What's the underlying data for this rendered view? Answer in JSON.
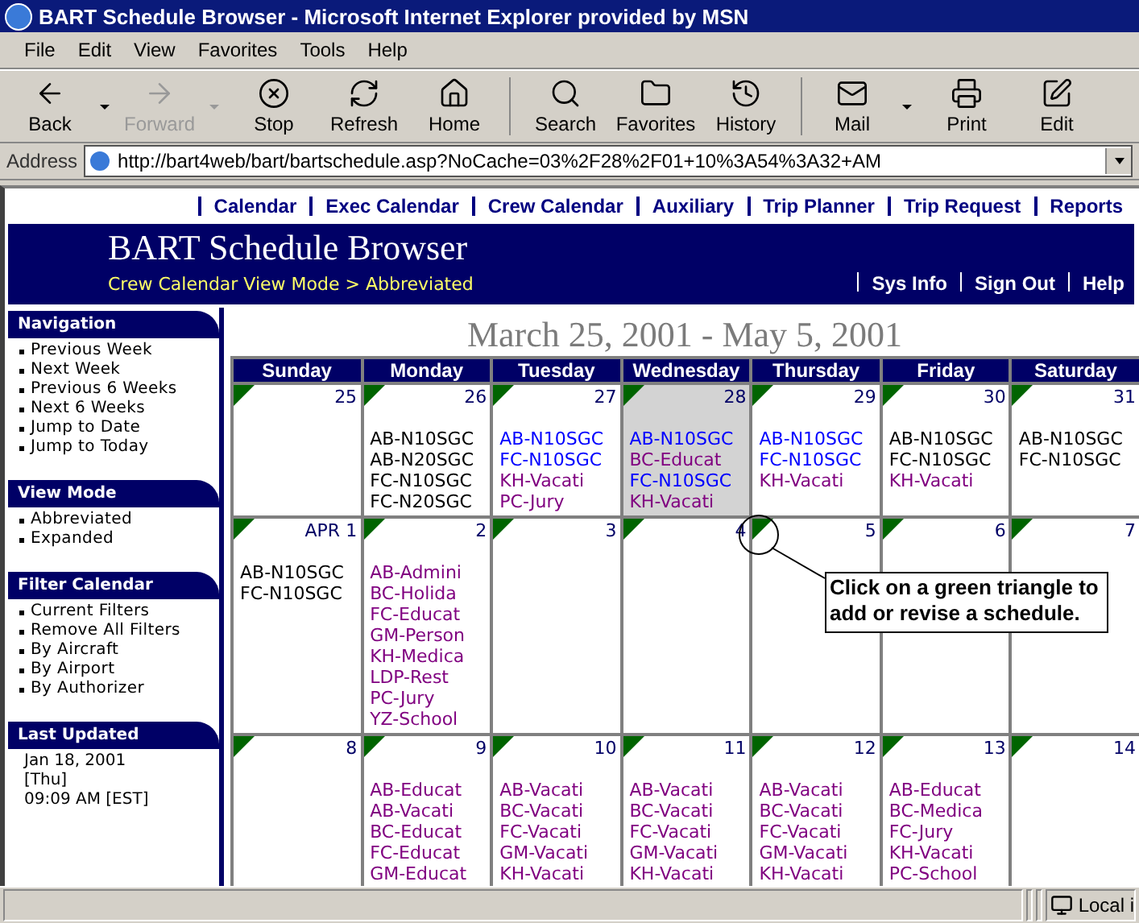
{
  "window": {
    "title": "BART Schedule Browser - Microsoft Internet Explorer provided by MSN"
  },
  "menu": [
    "File",
    "Edit",
    "View",
    "Favorites",
    "Tools",
    "Help"
  ],
  "toolbar": {
    "groups": [
      {
        "buttons": [
          {
            "kind": "back",
            "label": "Back",
            "disabled": false,
            "dropdown": true
          },
          {
            "kind": "forward",
            "label": "Forward",
            "disabled": true,
            "dropdown": true
          },
          {
            "kind": "stop",
            "label": "Stop",
            "disabled": false,
            "dropdown": false
          },
          {
            "kind": "refresh",
            "label": "Refresh",
            "disabled": false,
            "dropdown": false
          },
          {
            "kind": "home",
            "label": "Home",
            "disabled": false,
            "dropdown": false
          }
        ]
      },
      {
        "buttons": [
          {
            "kind": "search",
            "label": "Search",
            "disabled": false,
            "dropdown": false
          },
          {
            "kind": "favorites",
            "label": "Favorites",
            "disabled": false,
            "dropdown": false
          },
          {
            "kind": "history",
            "label": "History",
            "disabled": false,
            "dropdown": false
          }
        ]
      },
      {
        "buttons": [
          {
            "kind": "mail",
            "label": "Mail",
            "disabled": false,
            "dropdown": true
          },
          {
            "kind": "print",
            "label": "Print",
            "disabled": false,
            "dropdown": false
          },
          {
            "kind": "edit",
            "label": "Edit",
            "disabled": false,
            "dropdown": false
          }
        ]
      }
    ]
  },
  "address": {
    "label": "Address",
    "value": "http://bart4web/bart/bartschedule.asp?NoCache=03%2F28%2F01+10%3A54%3A32+AM"
  },
  "top_links": [
    "Calendar",
    "Exec Calendar",
    "Crew Calendar",
    "Auxiliary",
    "Trip Planner",
    "Trip Request",
    "Reports"
  ],
  "header": {
    "title": "BART Schedule Browser",
    "subtitle": "Crew Calendar View Mode > Abbreviated",
    "links": [
      "Sys Info",
      "Sign Out",
      "Help"
    ]
  },
  "sidebar": {
    "sections": [
      {
        "title": "Navigation",
        "items": [
          "Previous Week",
          "Next Week",
          "Previous 6 Weeks",
          "Next 6 Weeks",
          "Jump to Date",
          "Jump to Today"
        ]
      },
      {
        "title": "View Mode",
        "items": [
          "Abbreviated",
          "Expanded"
        ]
      },
      {
        "title": "Filter Calendar",
        "items": [
          "Current Filters",
          "Remove All Filters",
          "By Aircraft",
          "By Airport",
          "By Authorizer"
        ]
      }
    ],
    "last_updated": {
      "title": "Last Updated",
      "lines": [
        "Jan 18, 2001",
        "[Thu]",
        "09:09 AM [EST]"
      ]
    }
  },
  "calendar": {
    "title": "March 25, 2001 - May 5, 2001",
    "weekdays": [
      "Sunday",
      "Monday",
      "Tuesday",
      "Wednesday",
      "Thursday",
      "Friday",
      "Saturday"
    ],
    "weeks": [
      {
        "days": [
          {
            "date": "25",
            "selected": false
          },
          {
            "date": "26",
            "selected": false,
            "entries": [
              {
                "text": "AB-N10SGC",
                "color": "#000000"
              },
              {
                "text": "AB-N20SGC",
                "color": "#000000"
              },
              {
                "text": "FC-N10SGC",
                "color": "#000000"
              },
              {
                "text": "FC-N20SGC",
                "color": "#000000"
              }
            ]
          },
          {
            "date": "27",
            "selected": false,
            "entries": [
              {
                "text": "AB-N10SGC",
                "color": "#0000ff"
              },
              {
                "text": "FC-N10SGC",
                "color": "#0000ff"
              },
              {
                "text": "KH-Vacati",
                "color": "#800080"
              },
              {
                "text": "PC-Jury",
                "color": "#800080"
              }
            ]
          },
          {
            "date": "28",
            "selected": true,
            "entries": [
              {
                "text": "AB-N10SGC",
                "color": "#0000ff"
              },
              {
                "text": "BC-Educat",
                "color": "#800080"
              },
              {
                "text": "FC-N10SGC",
                "color": "#0000ff"
              },
              {
                "text": "KH-Vacati",
                "color": "#800080"
              }
            ]
          },
          {
            "date": "29",
            "selected": false,
            "entries": [
              {
                "text": "AB-N10SGC",
                "color": "#0000ff"
              },
              {
                "text": "FC-N10SGC",
                "color": "#0000ff"
              },
              {
                "text": "KH-Vacati",
                "color": "#800080"
              }
            ]
          },
          {
            "date": "30",
            "selected": false,
            "entries": [
              {
                "text": "AB-N10SGC",
                "color": "#000000"
              },
              {
                "text": "FC-N10SGC",
                "color": "#000000"
              },
              {
                "text": "KH-Vacati",
                "color": "#800080"
              }
            ]
          },
          {
            "date": "31",
            "selected": false,
            "entries": [
              {
                "text": "AB-N10SGC",
                "color": "#000000"
              },
              {
                "text": "FC-N10SGC",
                "color": "#000000"
              }
            ]
          }
        ]
      },
      {
        "days": [
          {
            "date": "APR 1",
            "selected": false,
            "entries": [
              {
                "text": "AB-N10SGC",
                "color": "#000000"
              },
              {
                "text": "FC-N10SGC",
                "color": "#000000"
              }
            ]
          },
          {
            "date": "2",
            "selected": false,
            "entries": [
              {
                "text": "AB-Admini",
                "color": "#800080"
              },
              {
                "text": "BC-Holida",
                "color": "#800080"
              },
              {
                "text": "FC-Educat",
                "color": "#800080"
              },
              {
                "text": "GM-Person",
                "color": "#800080"
              },
              {
                "text": "KH-Medica",
                "color": "#800080"
              },
              {
                "text": "LDP-Rest",
                "color": "#800080"
              },
              {
                "text": "PC-Jury",
                "color": "#800080"
              },
              {
                "text": "YZ-School",
                "color": "#800080"
              }
            ]
          },
          {
            "date": "3",
            "selected": false
          },
          {
            "date": "4",
            "selected": false
          },
          {
            "date": "5",
            "selected": false
          },
          {
            "date": "6",
            "selected": false
          },
          {
            "date": "7",
            "selected": false
          }
        ]
      },
      {
        "days": [
          {
            "date": "8",
            "selected": false
          },
          {
            "date": "9",
            "selected": false,
            "entries": [
              {
                "text": "AB-Educat",
                "color": "#800080"
              },
              {
                "text": "AB-Vacati",
                "color": "#800080"
              },
              {
                "text": "BC-Educat",
                "color": "#800080"
              },
              {
                "text": "FC-Educat",
                "color": "#800080"
              },
              {
                "text": "GM-Educat",
                "color": "#800080"
              }
            ]
          },
          {
            "date": "10",
            "selected": false,
            "entries": [
              {
                "text": "AB-Vacati",
                "color": "#800080"
              },
              {
                "text": "BC-Vacati",
                "color": "#800080"
              },
              {
                "text": "FC-Vacati",
                "color": "#800080"
              },
              {
                "text": "GM-Vacati",
                "color": "#800080"
              },
              {
                "text": "KH-Vacati",
                "color": "#800080"
              }
            ]
          },
          {
            "date": "11",
            "selected": false,
            "entries": [
              {
                "text": "AB-Vacati",
                "color": "#800080"
              },
              {
                "text": "BC-Vacati",
                "color": "#800080"
              },
              {
                "text": "FC-Vacati",
                "color": "#800080"
              },
              {
                "text": "GM-Vacati",
                "color": "#800080"
              },
              {
                "text": "KH-Vacati",
                "color": "#800080"
              }
            ]
          },
          {
            "date": "12",
            "selected": false,
            "entries": [
              {
                "text": "AB-Vacati",
                "color": "#800080"
              },
              {
                "text": "BC-Vacati",
                "color": "#800080"
              },
              {
                "text": "FC-Vacati",
                "color": "#800080"
              },
              {
                "text": "GM-Vacati",
                "color": "#800080"
              },
              {
                "text": "KH-Vacati",
                "color": "#800080"
              }
            ]
          },
          {
            "date": "13",
            "selected": false,
            "entries": [
              {
                "text": "AB-Educat",
                "color": "#800080"
              },
              {
                "text": "BC-Medica",
                "color": "#800080"
              },
              {
                "text": "FC-Jury",
                "color": "#800080"
              },
              {
                "text": "KH-Vacati",
                "color": "#800080"
              },
              {
                "text": "PC-School",
                "color": "#800080"
              }
            ]
          },
          {
            "date": "14",
            "selected": false
          }
        ]
      }
    ]
  },
  "callout": {
    "text": "Click on a green triangle to add or revise a schedule."
  },
  "status_bar": {
    "zone": "Local i"
  }
}
